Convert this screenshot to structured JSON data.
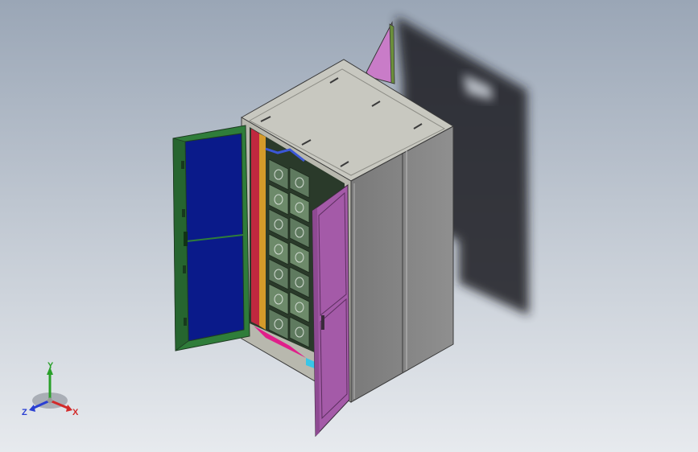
{
  "viewport": {
    "background_top": "#9aa6b6",
    "background_bottom": "#e7eaee"
  },
  "model": {
    "cabinet_body_color": "#8e8e8e",
    "cabinet_top_color": "#c9c9c1",
    "left_door_frame_color": "#2f7d3a",
    "left_door_panel_color": "#0a1a8a",
    "right_door_color": "#a45aa8",
    "shadow_color": "#1f1f22",
    "module_color": "#5f7a5f"
  },
  "triad": {
    "y_label": "Y",
    "x_label": "X",
    "z_label": "Z",
    "y_color": "#2aa02a",
    "x_color": "#d22a2a",
    "z_color": "#2a3fd2"
  }
}
